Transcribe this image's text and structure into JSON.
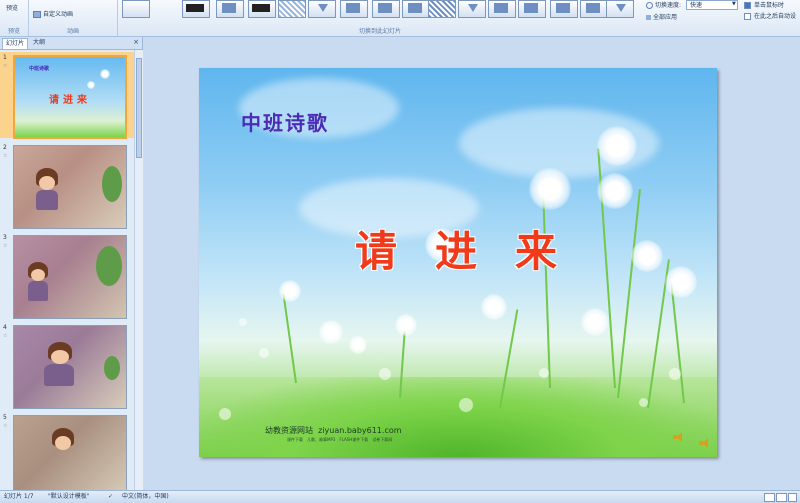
{
  "ribbon": {
    "preview_label": "预览",
    "preview_group_label": "预览",
    "custom_animation_label": "自定义动画",
    "animation_group_label": "动画",
    "transition_group_label": "切换到此幻灯片",
    "transition_speed_label": "切换速度:",
    "transition_speed_value": "快速",
    "apply_all_label": "全部应用",
    "on_click_label": "单击鼠标时",
    "after_label": "在此之后自动设"
  },
  "left_pane": {
    "tabs": [
      "幻灯片",
      "大纲"
    ],
    "close_symbol": "×",
    "slides": [
      {
        "number": "1",
        "title": "中班诗歌",
        "heading": "请进来"
      },
      {
        "number": "2"
      },
      {
        "number": "3"
      },
      {
        "number": "4"
      },
      {
        "number": "5"
      }
    ],
    "star": "☆"
  },
  "slide": {
    "title": "中班诗歌",
    "heading": "请进来",
    "site_name": "幼教资源网站",
    "site_url": "ziyuan.baby611.com",
    "site_links": "课件下载　儿歌、故事MP3　FLASH课件下载　试卷下载网"
  },
  "status_bar": {
    "slide_indicator": "幻灯片 1/7",
    "template": "\"默认设计模板\"",
    "language": "中文(简体，中国)"
  }
}
